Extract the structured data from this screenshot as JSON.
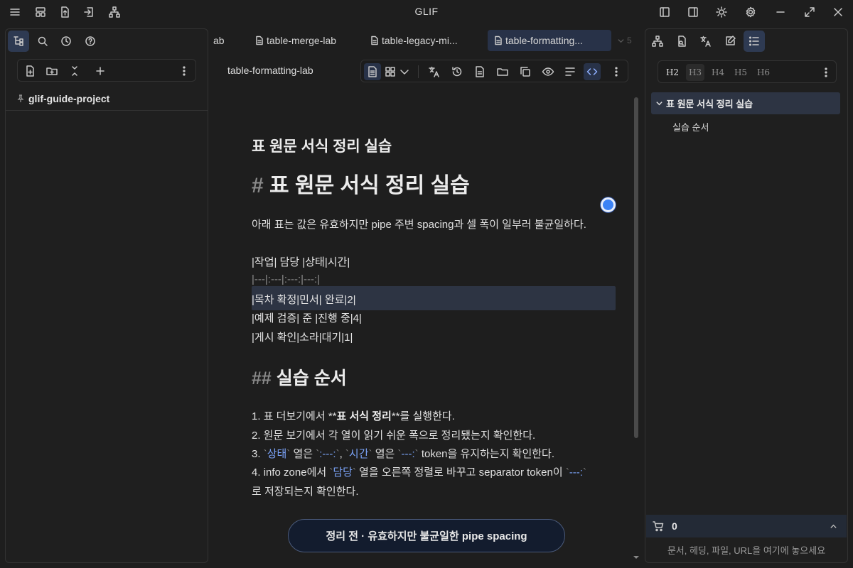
{
  "window": {
    "title": "GLIF"
  },
  "left": {
    "project_name": "glif-guide-project"
  },
  "tabs": [
    {
      "label": "ab"
    },
    {
      "label": "table-merge-lab"
    },
    {
      "label": "table-legacy-mi..."
    },
    {
      "label": "table-formatting..."
    },
    {
      "label": "5"
    }
  ],
  "editor": {
    "doc_title": "table-formatting-lab",
    "preview_title": "표 원문 서식 정리 실습",
    "h1_hash": "#",
    "h1_text": "표 원문 서식 정리 실습",
    "intro": "아래 표는 값은 유효하지만 pipe 주변 spacing과 셀 폭이 일부러 불균일하다.",
    "table_lines": [
      "|작업| 담당 |상태|시간|",
      "|---|:---|:---:|---:|",
      "|목차 확정|민서| 완료|2|",
      "|예제 검증| 준 |진행 중|4|",
      "|게시 확인|소라|대기|1|"
    ],
    "h2_hash": "##",
    "h2_text": "실습 순서",
    "step1": {
      "num": "1.",
      "pre": "표 더보기에서 **",
      "bold": "표 서식 정리",
      "post": "**를 실행한다."
    },
    "step2": "2. 원문 보기에서 각 열이 읽기 쉬운 폭으로 정리됐는지 확인한다.",
    "step3": {
      "num": "3.",
      "c1": "상태",
      "t1": "열은",
      "c2": ":---:",
      "comma": ",",
      "c3": "시간",
      "t2": "열은",
      "c4": "---:",
      "t3": "token을 유지하는지 확인한다."
    },
    "step4": {
      "num": "4.",
      "pre": "info zone에서",
      "c1": "담당",
      "mid": "열을 오른쪽 정렬로 바꾸고 separator token이",
      "c2": "---:",
      "wrap": "로 저장되는지 확인한다."
    },
    "status_pill": "정리 전 · 유효하지만 불균일한 pipe spacing"
  },
  "right": {
    "heading_levels": [
      "H2",
      "H3",
      "H4",
      "H5",
      "H6"
    ],
    "outline": [
      {
        "label": "표 원문 서식 정리 실습"
      },
      {
        "label": "실습 순서"
      }
    ],
    "cart_count": "0",
    "drop_hint": "문서, 헤딩, 파일, URL을 여기에 놓으세요"
  }
}
